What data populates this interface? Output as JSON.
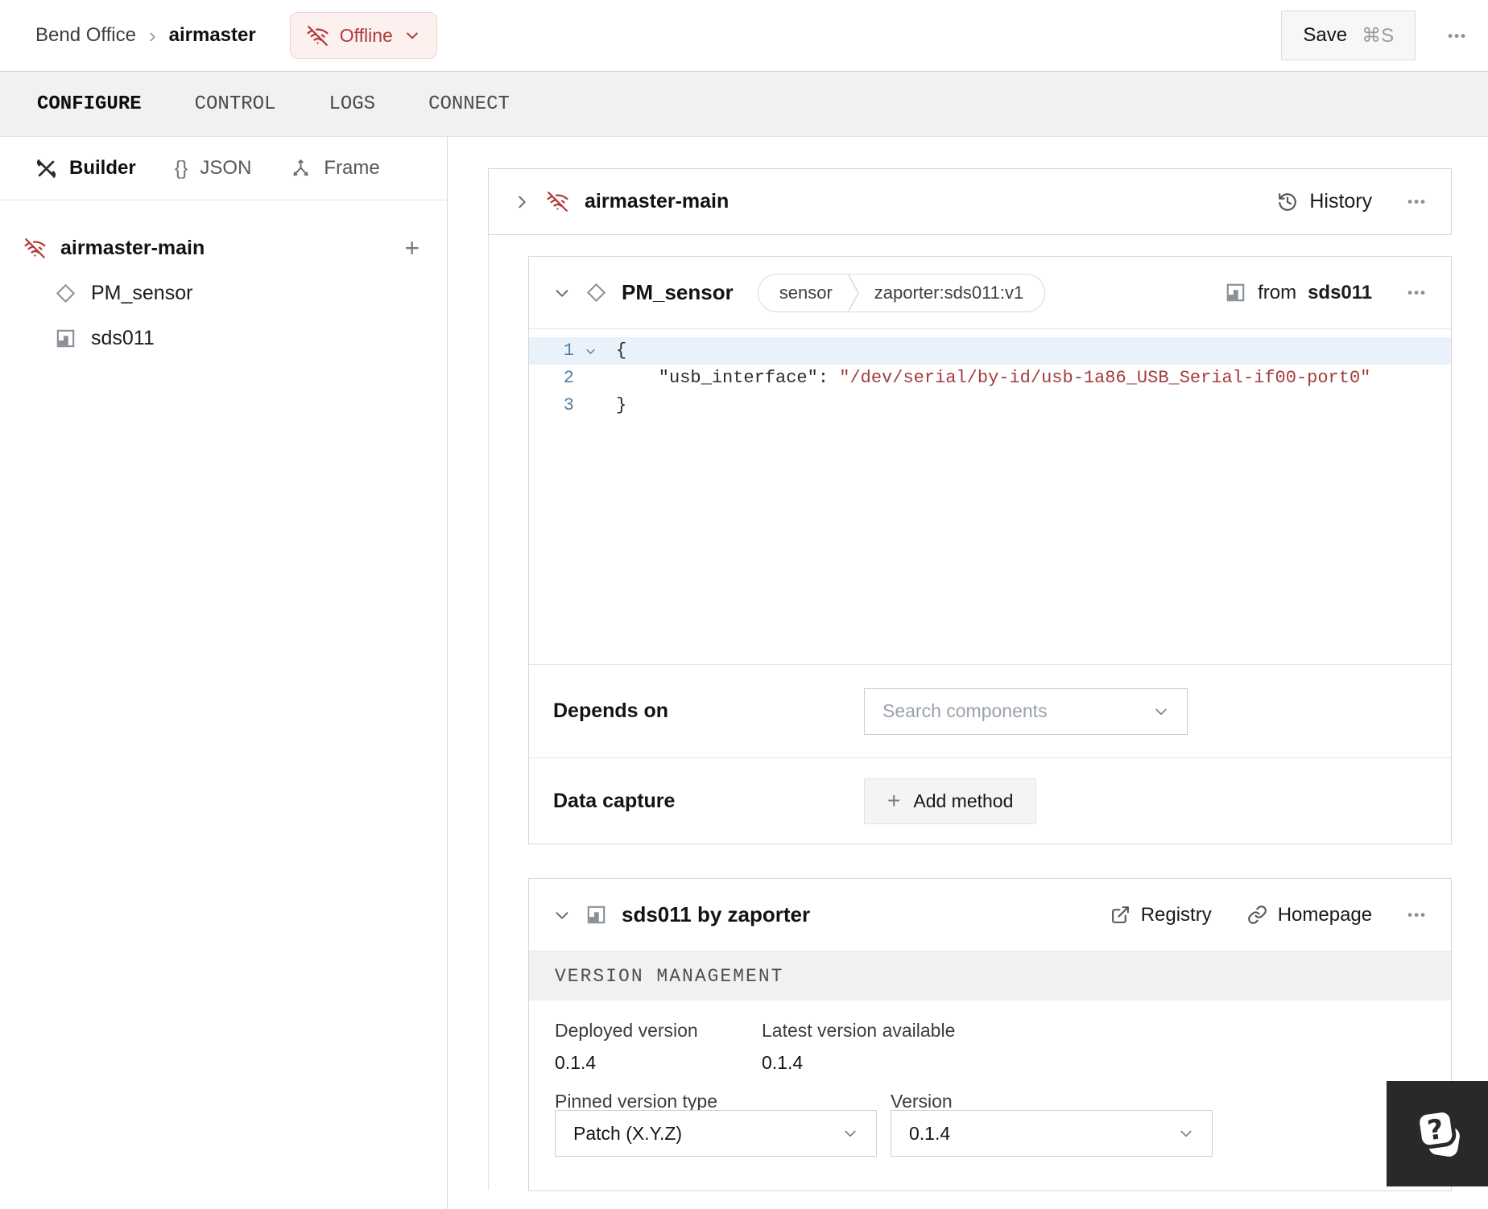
{
  "header": {
    "breadcrumb": {
      "root": "Bend Office",
      "separator": "›",
      "current": "airmaster"
    },
    "status": {
      "label": "Offline"
    },
    "save": {
      "label": "Save",
      "shortcut": "⌘S"
    }
  },
  "tabs": {
    "items": [
      {
        "label": "CONFIGURE"
      },
      {
        "label": "CONTROL"
      },
      {
        "label": "LOGS"
      },
      {
        "label": "CONNECT"
      }
    ]
  },
  "sidebar": {
    "views": [
      {
        "label": "Builder"
      },
      {
        "label": "JSON"
      },
      {
        "label": "Frame"
      }
    ],
    "tree": {
      "root": {
        "label": "airmaster-main"
      },
      "children": [
        {
          "label": "PM_sensor"
        },
        {
          "label": "sds011"
        }
      ]
    }
  },
  "machine": {
    "title": "airmaster-main",
    "history_label": "History"
  },
  "component": {
    "title": "PM_sensor",
    "tag_type": "sensor",
    "tag_model": "zaporter:sds011:v1",
    "from_prefix": "from",
    "from_module": "sds011",
    "code": {
      "lines": [
        {
          "num": "1",
          "text": "{"
        },
        {
          "num": "2",
          "key": "    \"usb_interface\":",
          "value": " \"/dev/serial/by-id/usb-1a86_USB_Serial-if00-port0\""
        },
        {
          "num": "3",
          "text": "}"
        }
      ]
    },
    "depends": {
      "label": "Depends on",
      "placeholder": "Search components"
    },
    "capture": {
      "label": "Data capture",
      "button": "Add method"
    }
  },
  "module": {
    "title": "sds011 by zaporter",
    "registry_label": "Registry",
    "homepage_label": "Homepage",
    "section_title": "VERSION MANAGEMENT",
    "deployed_label": "Deployed version",
    "deployed_value": "0.1.4",
    "latest_label": "Latest version available",
    "latest_value": "0.1.4",
    "pinned_label": "Pinned version type",
    "pinned_value": "Patch (X.Y.Z)",
    "version_label": "Version",
    "version_value": "0.1.4"
  },
  "icons": {
    "overflow": "•••",
    "plus": "+",
    "braces": "{}"
  },
  "colors": {
    "accent_red": "#ad3b39",
    "badge_bg": "#fdf1f0",
    "code_string": "#a23c3c",
    "line_number_blue": "#527ea3",
    "active_line_bg": "#e9f2fb",
    "help_bg": "#29292c"
  }
}
